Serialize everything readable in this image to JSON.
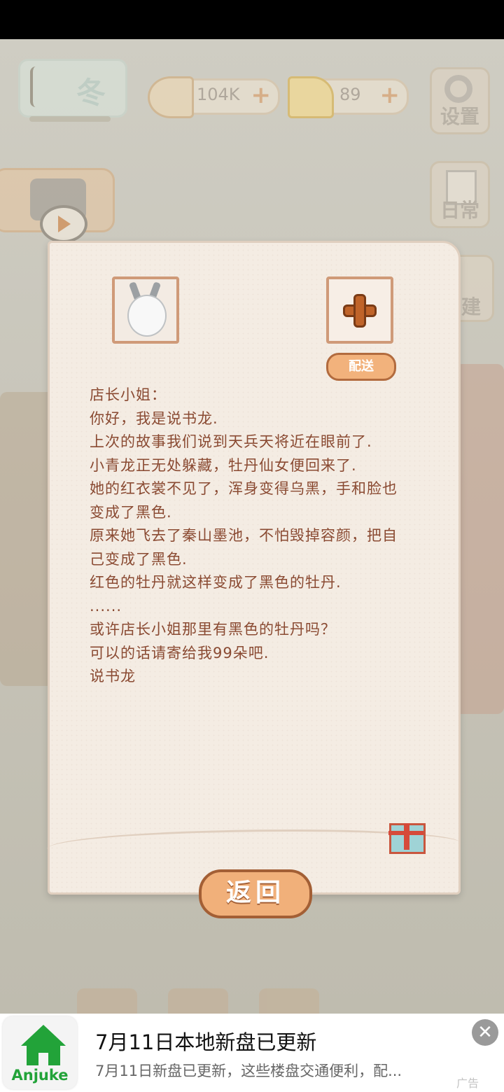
{
  "hud": {
    "season_label": "冬",
    "fish_value": "104K",
    "cheese_value": "89",
    "plus": "+",
    "settings_label": "设置",
    "daily_label": "日常",
    "build_label": "建"
  },
  "letter": {
    "deliver_label": "配送",
    "body": "店长小姐：\n你好，我是说书龙.\n上次的故事我们说到天兵天将近在眼前了.\n小青龙正无处躲藏，牡丹仙女便回来了.\n她的红衣裳不见了，浑身变得乌黑，手和脸也\n变成了黑色.\n原来她飞去了秦山墨池，不怕毁掉容颜，把自\n己变成了黑色.\n红色的牡丹就这样变成了黑色的牡丹.\n......\n或许店长小姐那里有黑色的牡丹吗？\n可以的话请寄给我99朵吧.\n说书龙",
    "return_label": "返回"
  },
  "ad": {
    "brand": "Anjuke",
    "title": "7月11日本地新盘已更新",
    "description": "7月11日新盘已更新，这些楼盘交通便利，配...",
    "close_symbol": "✕",
    "tag": "广告"
  }
}
